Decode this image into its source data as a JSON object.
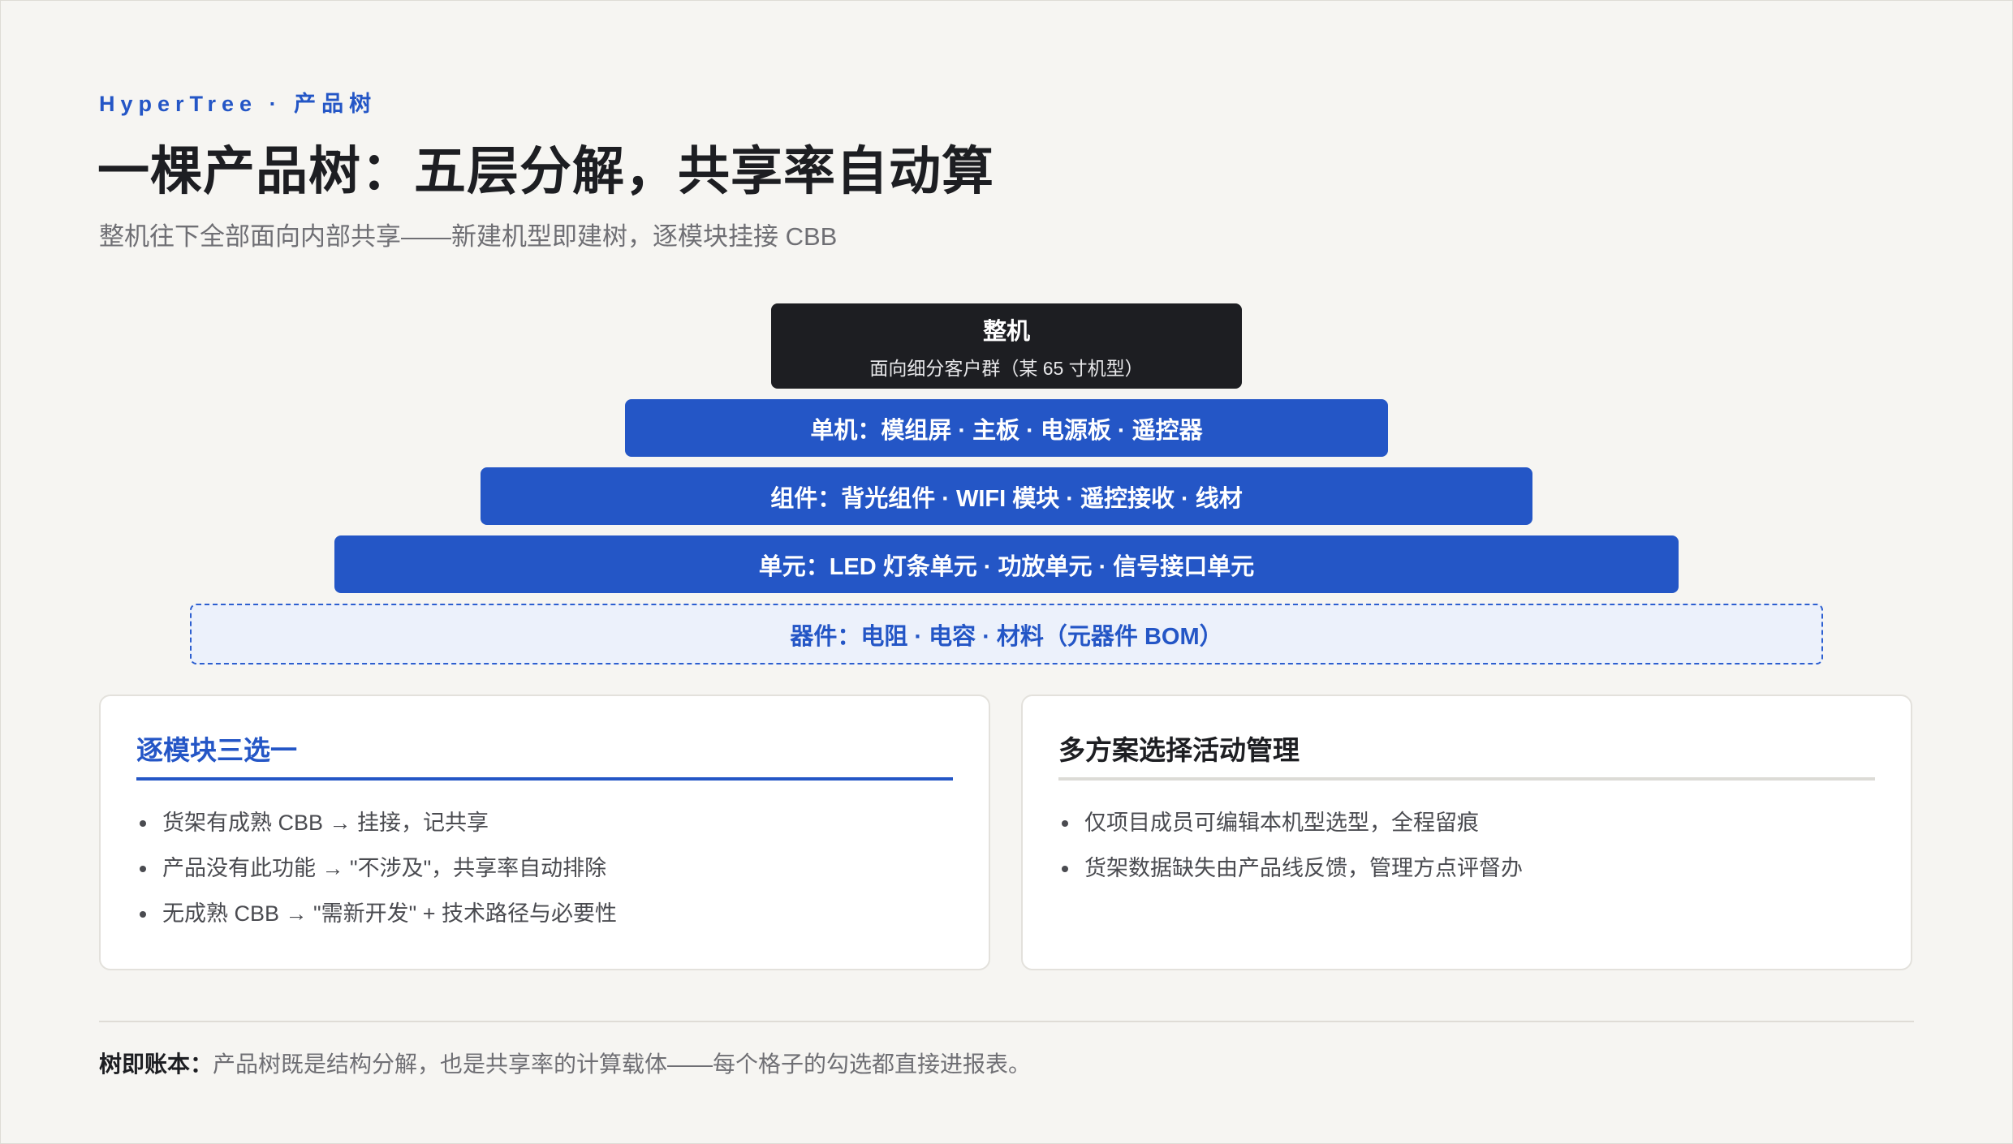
{
  "header": {
    "eyebrow": "HyperTree · 产品树",
    "title": "一棵产品树：五层分解，共享率自动算",
    "subtitle": "整机往下全部面向内部共享——新建机型即建树，逐模块挂接 CBB"
  },
  "pyramid": {
    "top": {
      "title": "整机",
      "subtitle": "面向细分客户群（某 65 寸机型）"
    },
    "levels": [
      "单机：模组屏 · 主板 · 电源板 · 遥控器",
      "组件：背光组件 · WIFI 模块 · 遥控接收 · 线材",
      "单元：LED 灯条单元 · 功放单元 · 信号接口单元",
      "器件：电阻 · 电容 · 材料（元器件 BOM）"
    ]
  },
  "cards": {
    "left": {
      "title": "逐模块三选一",
      "items": [
        "货架有成熟 CBB → 挂接，记共享",
        "产品没有此功能 → \"不涉及\"，共享率自动排除",
        "无成熟 CBB → \"需新开发\" + 技术路径与必要性"
      ]
    },
    "right": {
      "title": "多方案选择活动管理",
      "items": [
        "仅项目成员可编辑本机型选型，全程留痕",
        "货架数据缺失由产品线反馈，管理方点评督办"
      ]
    }
  },
  "footer": {
    "lead": "树即账本：",
    "text": "产品树既是结构分解，也是共享率的计算载体——每个格子的勾选都直接进报表。"
  },
  "colors": {
    "accent": "#2456c6",
    "dark": "#1d1e22",
    "background": "#f6f5f2",
    "dashed_fill": "#ecf1fb"
  }
}
